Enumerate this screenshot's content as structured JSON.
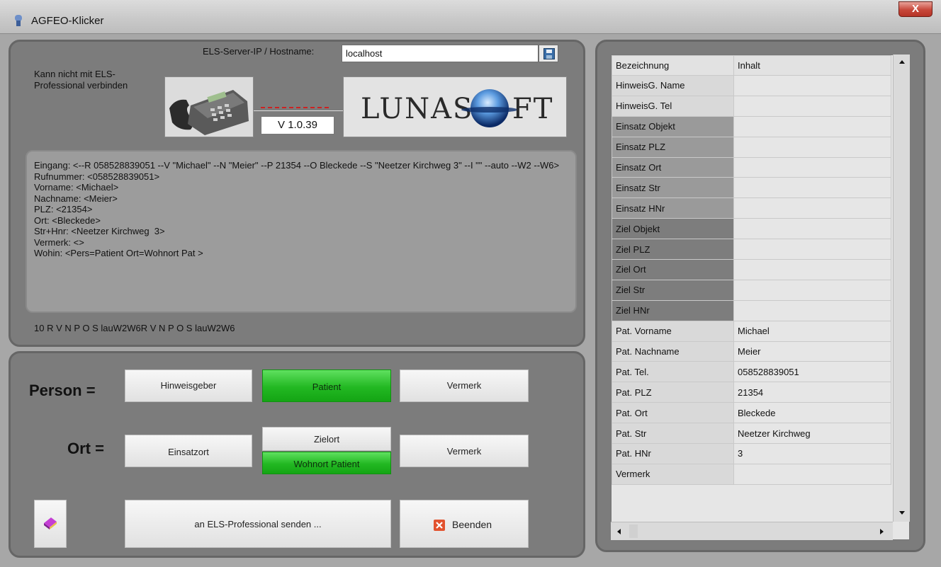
{
  "window": {
    "title": "AGFEO-Klicker",
    "close_label": "X"
  },
  "connection": {
    "server_label": "ELS-Server-IP / Hostname:",
    "server_value": "localhost",
    "status_text": "Kann nicht mit ELS-Professional verbinden",
    "version": "V 1.0.39",
    "logo_text": "LUNASOFT"
  },
  "log": {
    "lines": [
      "Eingang: <--R 058528839051 --V \"Michael\" --N \"Meier\" --P 21354 --O Bleckede --S \"Neetzer Kirchweg 3\" --I \"\" --auto --W2 --W6>",
      "",
      "Rufnummer: <058528839051>",
      "Vorname: <Michael>",
      "Nachname: <Meier>",
      "PLZ: <21354>",
      "Ort: <Bleckede>",
      "Str+Hnr: <Neetzer Kirchweg  3>",
      "Vermerk: <>",
      "Wohin: <Pers=Patient Ort=Wohnort Pat >"
    ],
    "status_line": "10 R V N P O S lauW2W6R V N P O S lauW2W6"
  },
  "person": {
    "label": "Person =",
    "buttons": {
      "hinweisgeber": "Hinweisgeber",
      "patient": "Patient",
      "vermerk": "Vermerk"
    }
  },
  "ort": {
    "label": "Ort =",
    "buttons": {
      "einsatzort": "Einsatzort",
      "zielort": "Zielort",
      "wohnort": "Wohnort Patient",
      "vermerk": "Vermerk"
    }
  },
  "actions": {
    "send": "an ELS-Professional senden ...",
    "quit": "Beenden"
  },
  "grid": {
    "columns": [
      "Bezeichnung",
      "Inhalt"
    ],
    "rows": [
      {
        "name": "HinweisG. Name",
        "value": ""
      },
      {
        "name": "HinweisG. Tel",
        "value": ""
      },
      {
        "name": "Einsatz Objekt",
        "value": ""
      },
      {
        "name": "Einsatz PLZ",
        "value": ""
      },
      {
        "name": "Einsatz Ort",
        "value": ""
      },
      {
        "name": "Einsatz Str",
        "value": ""
      },
      {
        "name": "Einsatz HNr",
        "value": ""
      },
      {
        "name": "Ziel Objekt",
        "value": ""
      },
      {
        "name": "Ziel PLZ",
        "value": ""
      },
      {
        "name": "Ziel Ort",
        "value": ""
      },
      {
        "name": "Ziel Str",
        "value": ""
      },
      {
        "name": "Ziel HNr",
        "value": ""
      },
      {
        "name": "Pat. Vorname",
        "value": "Michael"
      },
      {
        "name": "Pat. Nachname",
        "value": "Meier"
      },
      {
        "name": "Pat. Tel.",
        "value": "058528839051"
      },
      {
        "name": "Pat. PLZ",
        "value": "21354"
      },
      {
        "name": "Pat. Ort",
        "value": "Bleckede"
      },
      {
        "name": "Pat. Str",
        "value": "Neetzer Kirchweg"
      },
      {
        "name": "Pat. HNr",
        "value": "3"
      },
      {
        "name": "Vermerk",
        "value": ""
      }
    ]
  }
}
